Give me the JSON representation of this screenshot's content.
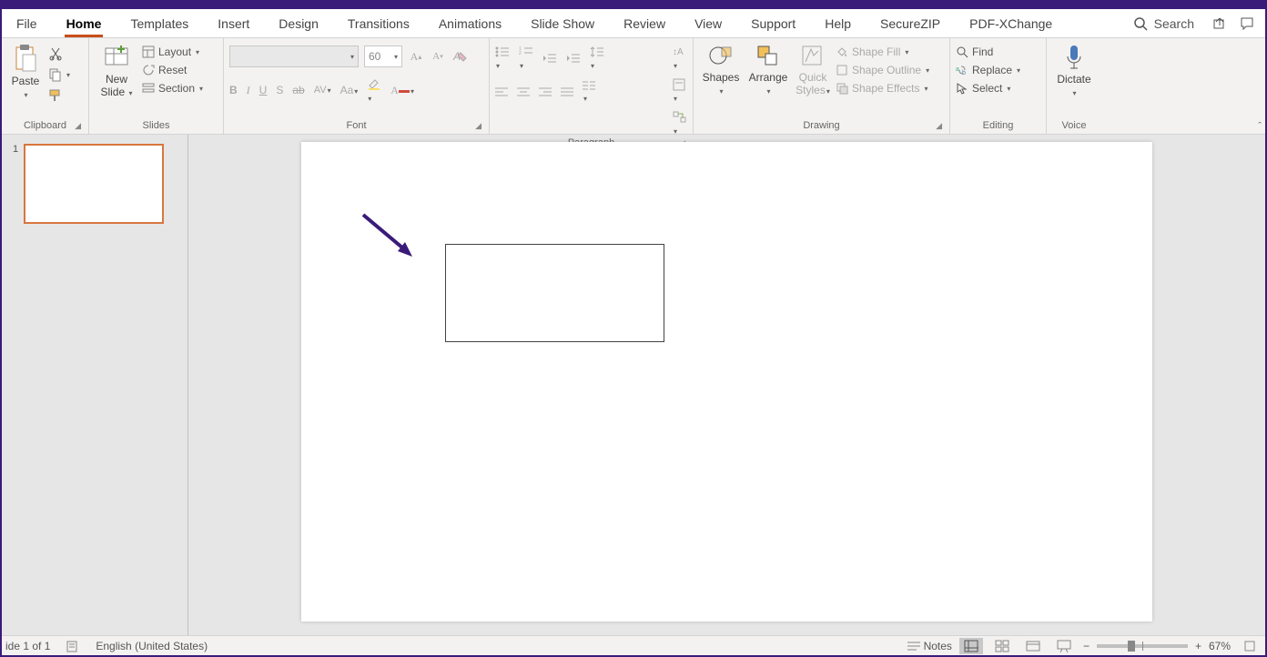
{
  "tabs": [
    "File",
    "Home",
    "Templates",
    "Insert",
    "Design",
    "Transitions",
    "Animations",
    "Slide Show",
    "Review",
    "View",
    "Support",
    "Help",
    "SecureZIP",
    "PDF-XChange"
  ],
  "active_tab": "Home",
  "search_placeholder": "Search",
  "clipboard": {
    "paste": "Paste",
    "label": "Clipboard"
  },
  "slides": {
    "new": "New Slide",
    "layout": "Layout",
    "reset": "Reset",
    "section": "Section",
    "label": "Slides"
  },
  "font": {
    "size": "60",
    "label": "Font"
  },
  "paragraph": {
    "label": "Paragraph"
  },
  "drawing": {
    "shapes": "Shapes",
    "arrange": "Arrange",
    "quick": "Quick Styles",
    "fill": "Shape Fill",
    "outline": "Shape Outline",
    "effects": "Shape Effects",
    "label": "Drawing"
  },
  "editing": {
    "find": "Find",
    "replace": "Replace",
    "select": "Select",
    "label": "Editing"
  },
  "voice": {
    "dictate": "Dictate",
    "label": "Voice"
  },
  "status": {
    "slide": "ide 1 of 1",
    "lang": "English (United States)",
    "notes": "Notes",
    "zoom": "67%"
  },
  "thumb_num": "1"
}
